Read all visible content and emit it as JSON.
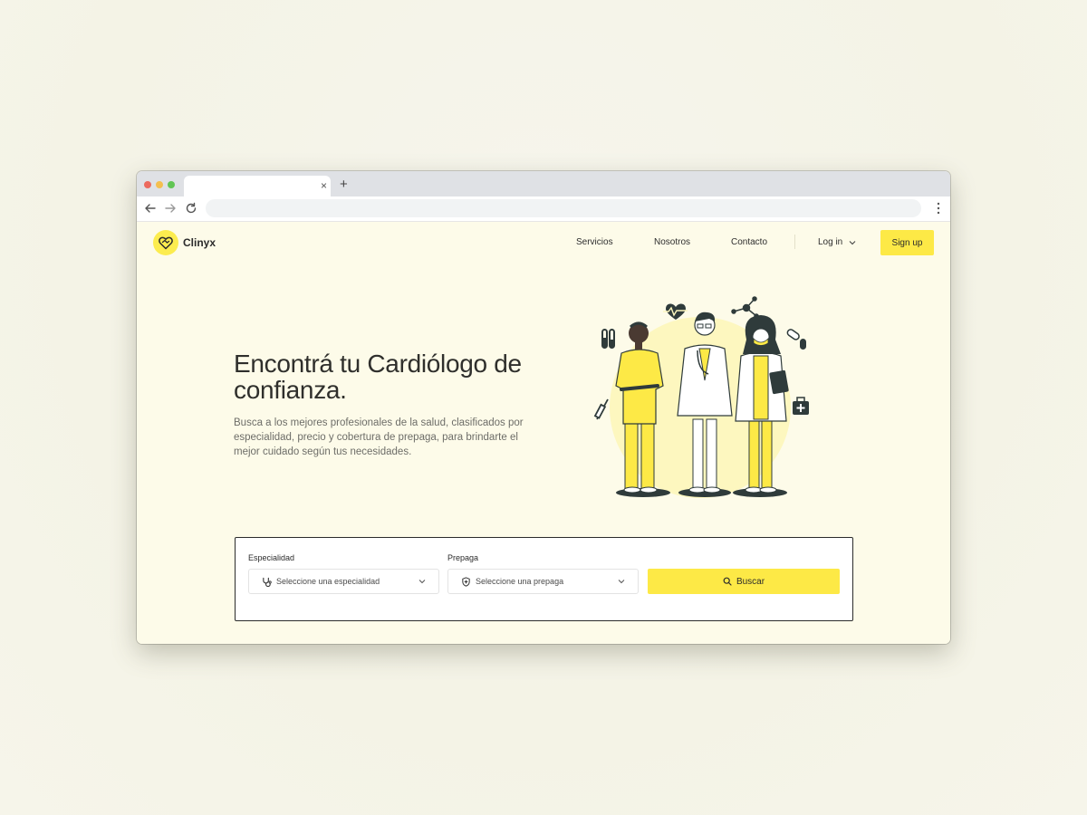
{
  "browser": {
    "tab_close": "×",
    "new_tab": "+",
    "url": ""
  },
  "brand": {
    "name": "Clinyx",
    "accent": "#fde946"
  },
  "nav": {
    "items": [
      "Servicios",
      "Nosotros",
      "Contacto"
    ],
    "login": "Log in",
    "signup": "Sign up"
  },
  "hero": {
    "title": "Encontrá tu Cardiólogo de confianza.",
    "description": "Busca a los mejores profesionales de la salud, clasificados por especialidad, precio y cobertura de prepaga, para brindarte el mejor cuidado según tus necesidades."
  },
  "search": {
    "specialty_label": "Especialidad",
    "specialty_placeholder": "Seleccione una especialidad",
    "insurance_label": "Prepaga",
    "insurance_placeholder": "Seleccione una prepaga",
    "button": "Buscar"
  },
  "icons": {
    "logo": "heart-handshake-icon",
    "specialty": "stethoscope-icon",
    "insurance": "shield-plus-icon",
    "search": "search-icon"
  }
}
